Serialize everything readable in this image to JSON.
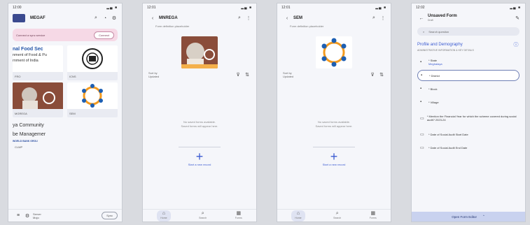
{
  "phone1": {
    "status_time": "12:00",
    "status_icons": "▂▄ ■",
    "title": "MEGAF",
    "banner_text": "Connect a sync service",
    "banner_btn": "Connect",
    "cards": [
      {
        "line1": "nal Food Sec",
        "line2": "nment of Food & Pu",
        "line3": "rnment of India",
        "label": "FRO"
      },
      {
        "label": "ICNS"
      },
      {
        "label": "MGREGA"
      },
      {
        "label": "SEM"
      },
      {
        "big1": "ya Community",
        "big2": "be Managemer",
        "wb": "WORLD BANK GROU",
        "label": "CLMP"
      }
    ],
    "nav_label": "Sync",
    "nav_small": "Server\nMojo"
  },
  "phone2": {
    "status_time": "12:01",
    "title": "MNREGA",
    "subtitle": "Form definition placeholder",
    "sort_label": "Sort by\nUpdated",
    "empty1": "No saved forms available.",
    "empty2": "Saved forms will appear here.",
    "create": "Start a new record",
    "nav": [
      "Home",
      "Search",
      "Forms"
    ]
  },
  "phone3": {
    "status_time": "12:01",
    "title": "SEM",
    "subtitle": "Form definition placeholder",
    "sort_label": "Sort by\nUpdated",
    "empty1": "No saved forms available.",
    "empty2": "Saved forms will appear here.",
    "create": "Start a new record",
    "nav": [
      "Home",
      "Search",
      "Forms"
    ]
  },
  "phone4": {
    "status_time": "12:02",
    "title": "Unsaved Form",
    "title_sub": "Draft",
    "search": "Search question",
    "section": "Profile and Demography",
    "section_sub": "ADMINISTRATIVE INFORMATION & KEY DETAILS",
    "fields": [
      {
        "label": "* State",
        "value": "Meghalaya"
      },
      {
        "label": "* District",
        "value": ""
      },
      {
        "label": "* Block",
        "value": ""
      },
      {
        "label": "* Village",
        "value": ""
      },
      {
        "label": "* Mention the Financial Year for which the scheme covered during social audit?",
        "value": "2023-24"
      },
      {
        "label": "* Date of Social Audit Start Date",
        "value": ""
      },
      {
        "label": "* Date of Social Audit End Date",
        "value": ""
      }
    ],
    "footer": "Open Form Editor"
  }
}
